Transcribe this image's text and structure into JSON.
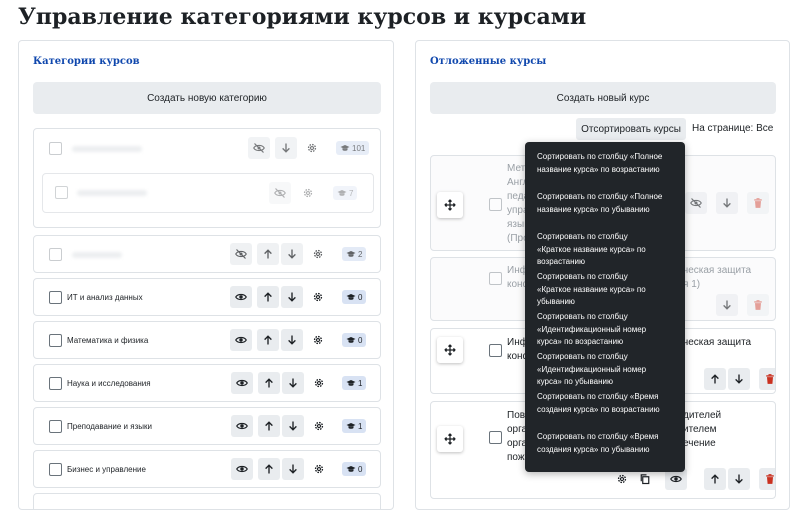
{
  "page_title": "Управление категориями курсов и курсами",
  "left_panel": {
    "heading": "Категории курсов",
    "create_button": "Создать новую категорию",
    "categories": [
      {
        "name": "",
        "count": "101"
      },
      {
        "name": "",
        "count": "7"
      },
      {
        "name": "",
        "count": "2"
      },
      {
        "name": "ИТ и анализ данных",
        "count": "0"
      },
      {
        "name": "Математика и физика",
        "count": "0"
      },
      {
        "name": "Наука и исследования",
        "count": "1"
      },
      {
        "name": "Преподавание и языки",
        "count": "1"
      },
      {
        "name": "Бизнес и управление",
        "count": "0"
      }
    ]
  },
  "right_panel": {
    "heading": "Отложенные курсы",
    "create_button": "Создать новый курс",
    "sort_button": "Отсортировать курсы",
    "per_page": "На странице: Все",
    "course_texts": {
      "c1_left": "Мет\nАнгл\nпеда\nупра\nязык\n(Про",
      "c1_right": "",
      "c2_left": "Инф\nконф",
      "c2_right": "ческая защита\nя 1)",
      "c3_left": "Инф\nконф",
      "c3_right": "ческая защита",
      "c4_left": "Пові\nорга\nорга\nпожа",
      "c4_right": "дителей\nителем\nечение"
    }
  },
  "sort_menu": {
    "items": [
      "Сортировать по столбцу «Полное\nназвание курса» по возрастанию",
      "Сортировать по столбцу «Полное\nназвание курса» по убыванию",
      "Сортировать по столбцу\n«Краткое название курса» по\nвозрастанию",
      "Сортировать по столбцу\n«Краткое название курса» по\nубыванию",
      "Сортировать по столбцу\n«Идентификационный номер\nкурса» по возрастанию",
      "Сортировать по столбцу\n«Идентификационный номер\nкурса» по убыванию",
      "Сортировать по столбцу «Время\nсоздания курса» по возрастанию",
      "Сортировать по столбцу «Время\nсоздания курса» по убыванию"
    ]
  },
  "colors": {
    "accent": "#0f47ad",
    "badge": "#d8e2f3",
    "danger": "#ca3120",
    "menu": "#212529"
  }
}
